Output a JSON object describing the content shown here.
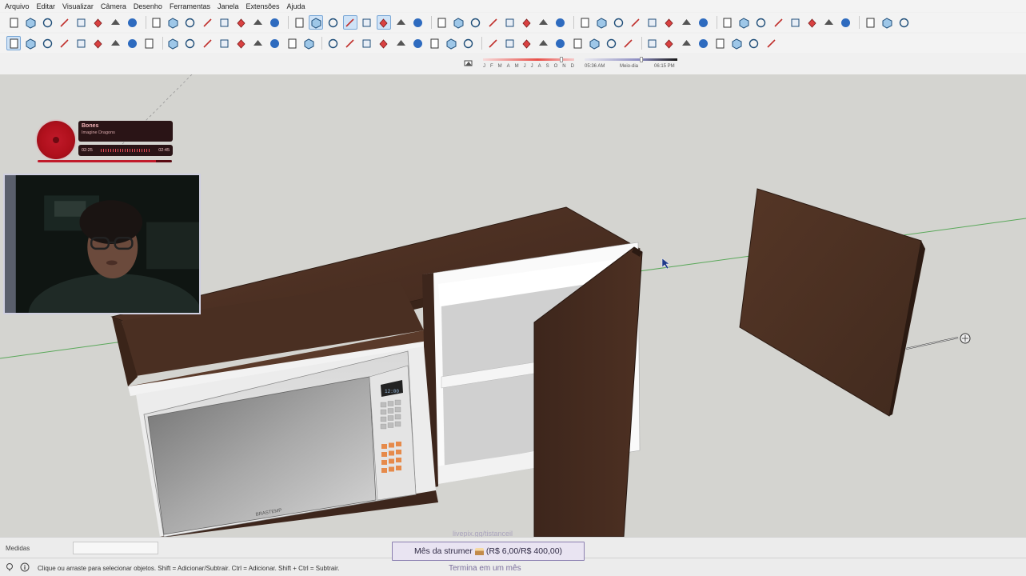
{
  "menu": [
    "Arquivo",
    "Editar",
    "Visualizar",
    "Câmera",
    "Desenho",
    "Ferramentas",
    "Janela",
    "Extensões",
    "Ajuda"
  ],
  "toolbar1_icons": [
    "new-file-icon",
    "open-icon",
    "save-icon",
    "cut-icon",
    "copy-icon",
    "paste-icon",
    "erase-icon",
    "undo-icon",
    "redo-icon",
    "print-icon",
    "model-info-icon",
    "iso-view-icon",
    "top-view-icon",
    "front-view-icon",
    "right-view-icon",
    "back-view-icon",
    "left-view-icon",
    "xray-icon",
    "back-edges-icon",
    "wireframe-icon",
    "hidden-line-icon",
    "shaded-icon",
    "shaded-textures-icon",
    "monochrome-icon",
    "push-pull-icon",
    "follow-me-icon",
    "offset-icon",
    "intersect-icon",
    "outer-shell-icon",
    "union-icon",
    "subtract-icon",
    "trim-icon",
    "split-icon",
    "sandbox-from-contours-icon",
    "sandbox-from-scratch-icon",
    "smoove-icon",
    "stamp-icon",
    "drape-icon",
    "add-detail-icon",
    "flip-edge-icon",
    "styles-icon",
    "components-icon",
    "materials-icon",
    "scenes-icon",
    "shadows-icon",
    "fog-icon",
    "section-plane-icon",
    "warehouse-icon",
    "extension-warehouse-icon",
    "extension-manager-icon",
    "account-icon"
  ],
  "toolbar2_icons": [
    "select-icon",
    "component-icon",
    "paint-bucket-icon",
    "eraser-icon",
    "line-icon",
    "freehand-icon",
    "rectangle-icon",
    "rotated-rectangle-icon",
    "circle-icon",
    "polygon-icon",
    "arc-icon",
    "two-point-arc-icon",
    "three-point-arc-icon",
    "pie-icon",
    "move-icon",
    "push-pull-icon",
    "rotate-icon",
    "follow-me-icon",
    "scale-icon",
    "offset-icon",
    "tape-measure-icon",
    "dimension-icon",
    "protractor-icon",
    "text-icon",
    "axes-icon",
    "3d-text-icon",
    "section-plane-icon",
    "section-cut-icon",
    "section-fill-icon",
    "orbit-icon",
    "pan-icon",
    "zoom-icon",
    "zoom-window-icon",
    "zoom-extents-icon",
    "previous-view-icon",
    "position-camera-icon",
    "look-around-icon",
    "walk-icon",
    "add-location-icon",
    "terrain-icon",
    "photo-textures-icon",
    "sandbox-icon",
    "dynamic-component-icon",
    "layout-icon"
  ],
  "shadow": {
    "months": [
      "J",
      "F",
      "M",
      "A",
      "M",
      "J",
      "J",
      "A",
      "S",
      "O",
      "N",
      "D"
    ],
    "time_start": "05:36 AM",
    "time_mid": "Meio-dia",
    "time_end": "06:15 PM"
  },
  "music": {
    "title": "Bones",
    "artist": "Imagine Dragons",
    "elapsed": "02:25",
    "duration": "02:45",
    "progress": 0.88
  },
  "measures_label": "Medidas",
  "status_message": "Clique ou arraste para selecionar objetos. Shift = Adicionar/Subtrair. Ctrl = Adicionar. Shift + Ctrl = Subtrair.",
  "overlay": {
    "url": "livepix.gg/tistanceil",
    "subgoal_before": "Mês da strumer",
    "subgoal_after": "(R$ 6,00/R$ 400,00)",
    "ends": "Termina em um mês"
  },
  "microwave": {
    "brand": "BRASTEMP",
    "clock": "12:00"
  },
  "colors": {
    "wood": "#4a2e22",
    "wood_light": "#5a3828",
    "background": "#d4d4d0",
    "axis_green": "#4caf50",
    "accent_red": "#b0101c"
  }
}
